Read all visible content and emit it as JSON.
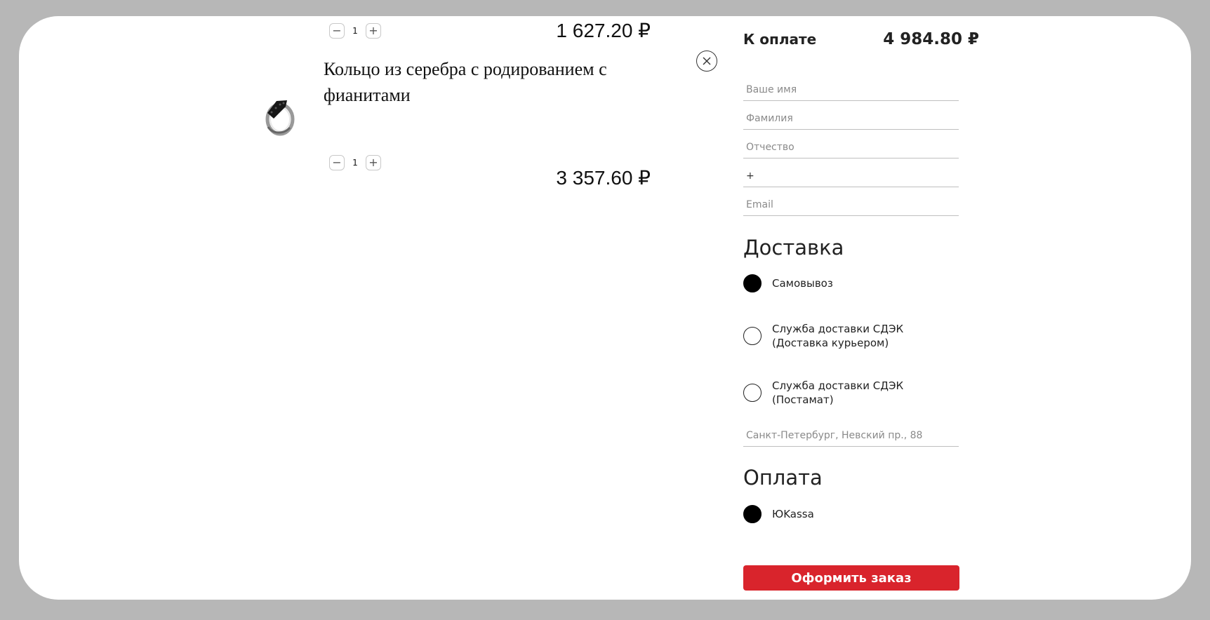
{
  "cart": {
    "items": [
      {
        "quantity": "1",
        "price": "1 627.20 ₽"
      },
      {
        "title": "Кольцо из серебра с родированием с фианитами",
        "quantity": "1",
        "price": "3 357.60 ₽"
      }
    ]
  },
  "summary": {
    "total_label": "К оплате",
    "total_value": "4 984.80 ₽"
  },
  "form": {
    "name_placeholder": "Ваше имя",
    "surname_placeholder": "Фамилия",
    "patronymic_placeholder": "Отчество",
    "phone_value": "+",
    "email_placeholder": "Email",
    "address_placeholder": "Санкт-Петербург, Невский пр., 88"
  },
  "delivery": {
    "title": "Доставка",
    "options": [
      {
        "label": "Самовывоз",
        "checked": true
      },
      {
        "label_line1": "Служба доставки СДЭК",
        "label_line2": "(Доставка курьером)",
        "checked": false
      },
      {
        "label_line1": "Служба доставки СДЭК",
        "label_line2": "(Постамат)",
        "checked": false
      }
    ]
  },
  "payment": {
    "title": "Оплата",
    "options": [
      {
        "label": "ЮKassa",
        "checked": true
      }
    ]
  },
  "actions": {
    "submit_label": "Оформить заказ"
  },
  "colors": {
    "accent": "#d9242c",
    "frame_background": "#b7b7b7"
  },
  "icons": {
    "minus": "minus-icon",
    "plus": "plus-icon",
    "remove": "close-icon",
    "product": "ring-image"
  }
}
